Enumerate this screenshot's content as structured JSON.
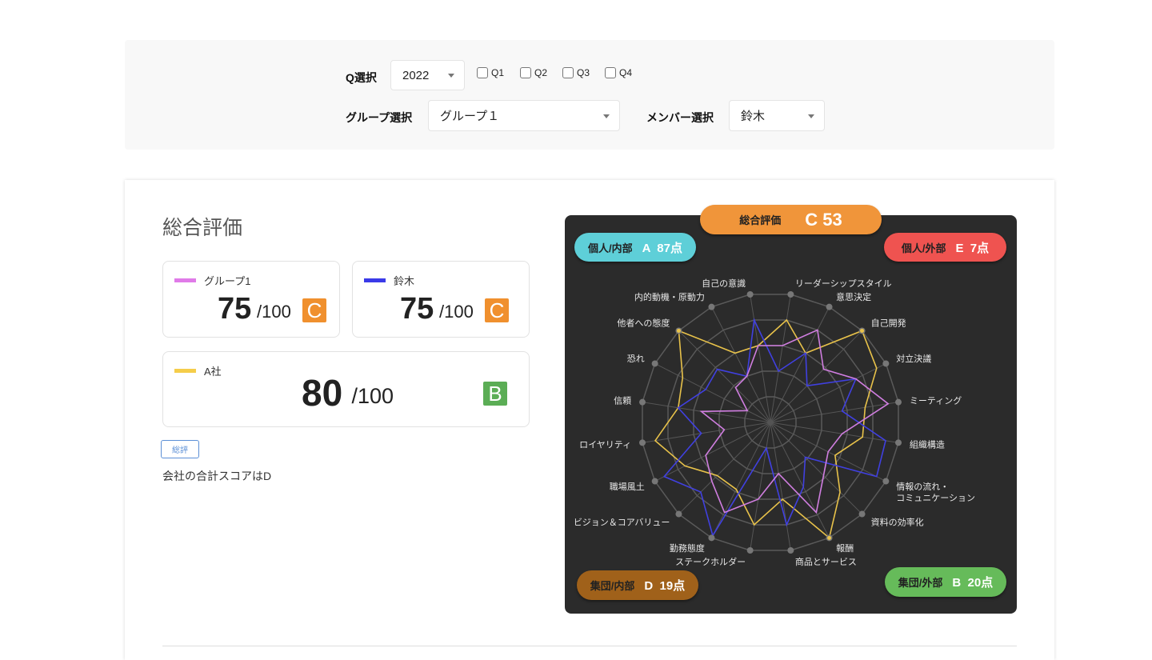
{
  "filters": {
    "q_label": "Q選択",
    "year": "2022",
    "quarters": [
      "Q1",
      "Q2",
      "Q3",
      "Q4"
    ],
    "group_label": "グループ選択",
    "group_value": "グループ１",
    "member_label": "メンバー選択",
    "member_value": "鈴木"
  },
  "summary": {
    "title": "総合評価",
    "cards": [
      {
        "name": "グループ1",
        "score": "75",
        "max": "/100",
        "grade": "C",
        "color": "#e07be8",
        "grade_color": "#f0902e"
      },
      {
        "name": "鈴木",
        "score": "75",
        "max": "/100",
        "grade": "C",
        "color": "#3a3ae8",
        "grade_color": "#f0902e"
      },
      {
        "name": "A社",
        "score": "80",
        "max": " /100",
        "grade": "B",
        "color": "#f5cd4a",
        "grade_color": "#5bad55"
      }
    ],
    "tag": "総評",
    "note": "会社の合計スコアはD"
  },
  "badges": {
    "overall": {
      "label": "総合評価",
      "value": "C 53",
      "color": "#f0953a"
    },
    "personal_internal": {
      "label": "個人/内部",
      "value": "A  87点",
      "color": "#5ecfd8"
    },
    "personal_external": {
      "label": "個人/外部",
      "value": "E  7点",
      "color": "#ef5350"
    },
    "group_internal": {
      "label": "集団/内部",
      "value": "D  19点",
      "color": "#a0611a"
    },
    "group_external": {
      "label": "集団/外部",
      "value": "B  20点",
      "color": "#66bb5a"
    }
  },
  "chart_data": {
    "type": "radar",
    "range": [
      0,
      5
    ],
    "categories": [
      "自己の意識",
      "リーダーシップスタイル",
      "意思決定",
      "自己開発",
      "対立決議",
      "ミーティング",
      "組織構造",
      "情報の流れ・\nコミュニケーション",
      "資料の効率化",
      "報酬",
      "商品とサービス",
      "ステークホルダー",
      "勤務態度",
      "ビジョン＆コアバリュー",
      "職場風土",
      "ロイヤリティ",
      "信頼",
      "恐れ",
      "他者への態度",
      "内的動機・原動力"
    ],
    "series": [
      {
        "name": "A社",
        "color": "#e8c24a",
        "values": [
          3,
          4,
          3,
          5,
          4.6,
          3.7,
          3.6,
          2.8,
          3.8,
          5,
          3,
          4,
          2.9,
          2.9,
          3.7,
          4.5,
          3.6,
          3.8,
          5,
          3
        ]
      },
      {
        "name": "鈴木",
        "color": "#4040e0",
        "values": [
          4,
          2,
          3,
          2,
          3.7,
          2.8,
          4.5,
          4.6,
          1.9,
          2.8,
          4,
          1,
          4.9,
          3.8,
          4.6,
          2.7,
          3.6,
          2.8,
          2.9,
          2
        ]
      },
      {
        "name": "グループ1",
        "color": "#d07ee0",
        "values": [
          3,
          3,
          4,
          2.9,
          3.7,
          4.6,
          2.8,
          2.5,
          2.9,
          3.9,
          2,
          3,
          3.9,
          3.2,
          2.8,
          1.8,
          2.7,
          1,
          1.9,
          2
        ]
      }
    ]
  }
}
